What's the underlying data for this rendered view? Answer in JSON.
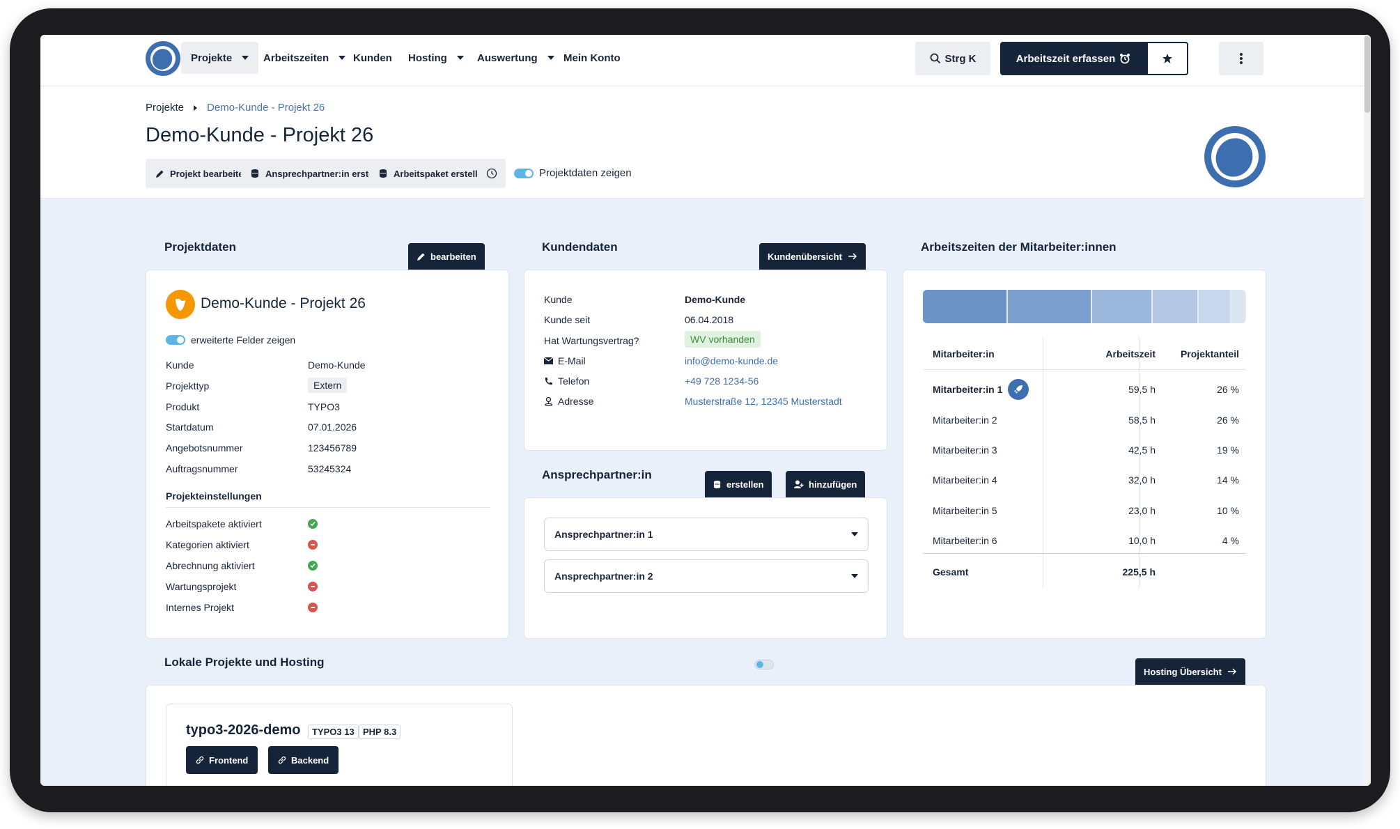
{
  "nav": {
    "items": [
      {
        "label": "Projekte",
        "dropdown": true
      },
      {
        "label": "Arbeitszeiten",
        "dropdown": true
      },
      {
        "label": "Kunden",
        "dropdown": false
      },
      {
        "label": "Hosting",
        "dropdown": true
      },
      {
        "label": "Auswertung",
        "dropdown": true
      },
      {
        "label": "Mein Konto",
        "dropdown": false
      }
    ],
    "search_label": "Strg K",
    "primary_label": "Arbeitszeit erfassen"
  },
  "breadcrumb": {
    "root": "Projekte",
    "current": "Demo-Kunde - Projekt 26"
  },
  "page": {
    "title": "Demo-Kunde - Projekt 26"
  },
  "actions": {
    "edit": "Projekt bearbeiten",
    "create_contact": "Ansprechpartner:in erstellen",
    "create_package": "Arbeitspaket erstellen",
    "toggle_label": "Projektdaten zeigen"
  },
  "projektdaten": {
    "section_title": "Projektdaten",
    "edit_label": "bearbeiten",
    "card_title": "Demo-Kunde - Projekt 26",
    "toggle_label": "erweiterte Felder zeigen",
    "fields": [
      {
        "label": "Kunde",
        "value": "Demo-Kunde"
      },
      {
        "label": "Projekttyp",
        "value": "Extern"
      },
      {
        "label": "Produkt",
        "value": "TYPO3"
      },
      {
        "label": "Startdatum",
        "value": "07.01.2026"
      },
      {
        "label": "Angebotsnummer",
        "value": "123456789"
      },
      {
        "label": "Auftragsnummer",
        "value": "53245324"
      }
    ],
    "settings_title": "Projekteinstellungen",
    "settings": [
      {
        "label": "Arbeitspakete aktiviert",
        "state": "on"
      },
      {
        "label": "Kategorien aktiviert",
        "state": "off"
      },
      {
        "label": "Abrechnung aktiviert",
        "state": "on"
      },
      {
        "label": "Wartungsprojekt",
        "state": "off"
      },
      {
        "label": "Internes Projekt",
        "state": "off"
      }
    ]
  },
  "kundendaten": {
    "section_title": "Kundendaten",
    "overview_label": "Kundenübersicht",
    "fields": [
      {
        "label": "Kunde",
        "value": "Demo-Kunde"
      },
      {
        "label": "Kunde seit",
        "value": "06.04.2018"
      },
      {
        "label": "Hat Wartungsvertrag?",
        "value": "WV vorhanden"
      },
      {
        "label": "E-Mail",
        "value": "info@demo-kunde.de"
      },
      {
        "label": "Telefon",
        "value": "+49 728 1234-56"
      },
      {
        "label": "Adresse",
        "value": "Musterstraße 12, 12345 Musterstadt"
      }
    ]
  },
  "ansprechpartner": {
    "section_title": "Ansprechpartner:in",
    "create_label": "erstellen",
    "add_label": "hinzufügen",
    "items": [
      "Ansprechpartner:in 1",
      "Ansprechpartner:in 2"
    ]
  },
  "arbeitszeiten": {
    "section_title": "Arbeitszeiten der Mitarbeiter:innen",
    "headers": [
      "Mitarbeiter:in",
      "Arbeitszeit",
      "Projektanteil"
    ],
    "rows": [
      {
        "name": "Mitarbeiter:in 1",
        "time": "59,5 h",
        "share": "26 %"
      },
      {
        "name": "Mitarbeiter:in 2",
        "time": "58,5 h",
        "share": "26 %"
      },
      {
        "name": "Mitarbeiter:in 3",
        "time": "42,5 h",
        "share": "19 %"
      },
      {
        "name": "Mitarbeiter:in 4",
        "time": "32,0 h",
        "share": "14 %"
      },
      {
        "name": "Mitarbeiter:in 5",
        "time": "23,0 h",
        "share": "10 %"
      },
      {
        "name": "Mitarbeiter:in 6",
        "time": "10,0 h",
        "share": "4 %"
      }
    ],
    "total_label": "Gesamt",
    "total_time": "225,5 h",
    "bar_values": [
      59.5,
      58.5,
      42.5,
      32.0,
      23.0,
      10.0
    ],
    "bar_colors": [
      "#6b93c6",
      "#7c9fcd",
      "#9bb6db",
      "#b4c8e4",
      "#c9d8ec",
      "#dce6f3"
    ]
  },
  "hosting": {
    "section_title": "Lokale Projekte und Hosting",
    "overview_label": "Hosting Übersicht",
    "project_name": "typo3-2026-demo",
    "tags": [
      "TYPO3 13",
      "PHP 8.3"
    ],
    "frontend_label": "Frontend",
    "backend_label": "Backend"
  }
}
